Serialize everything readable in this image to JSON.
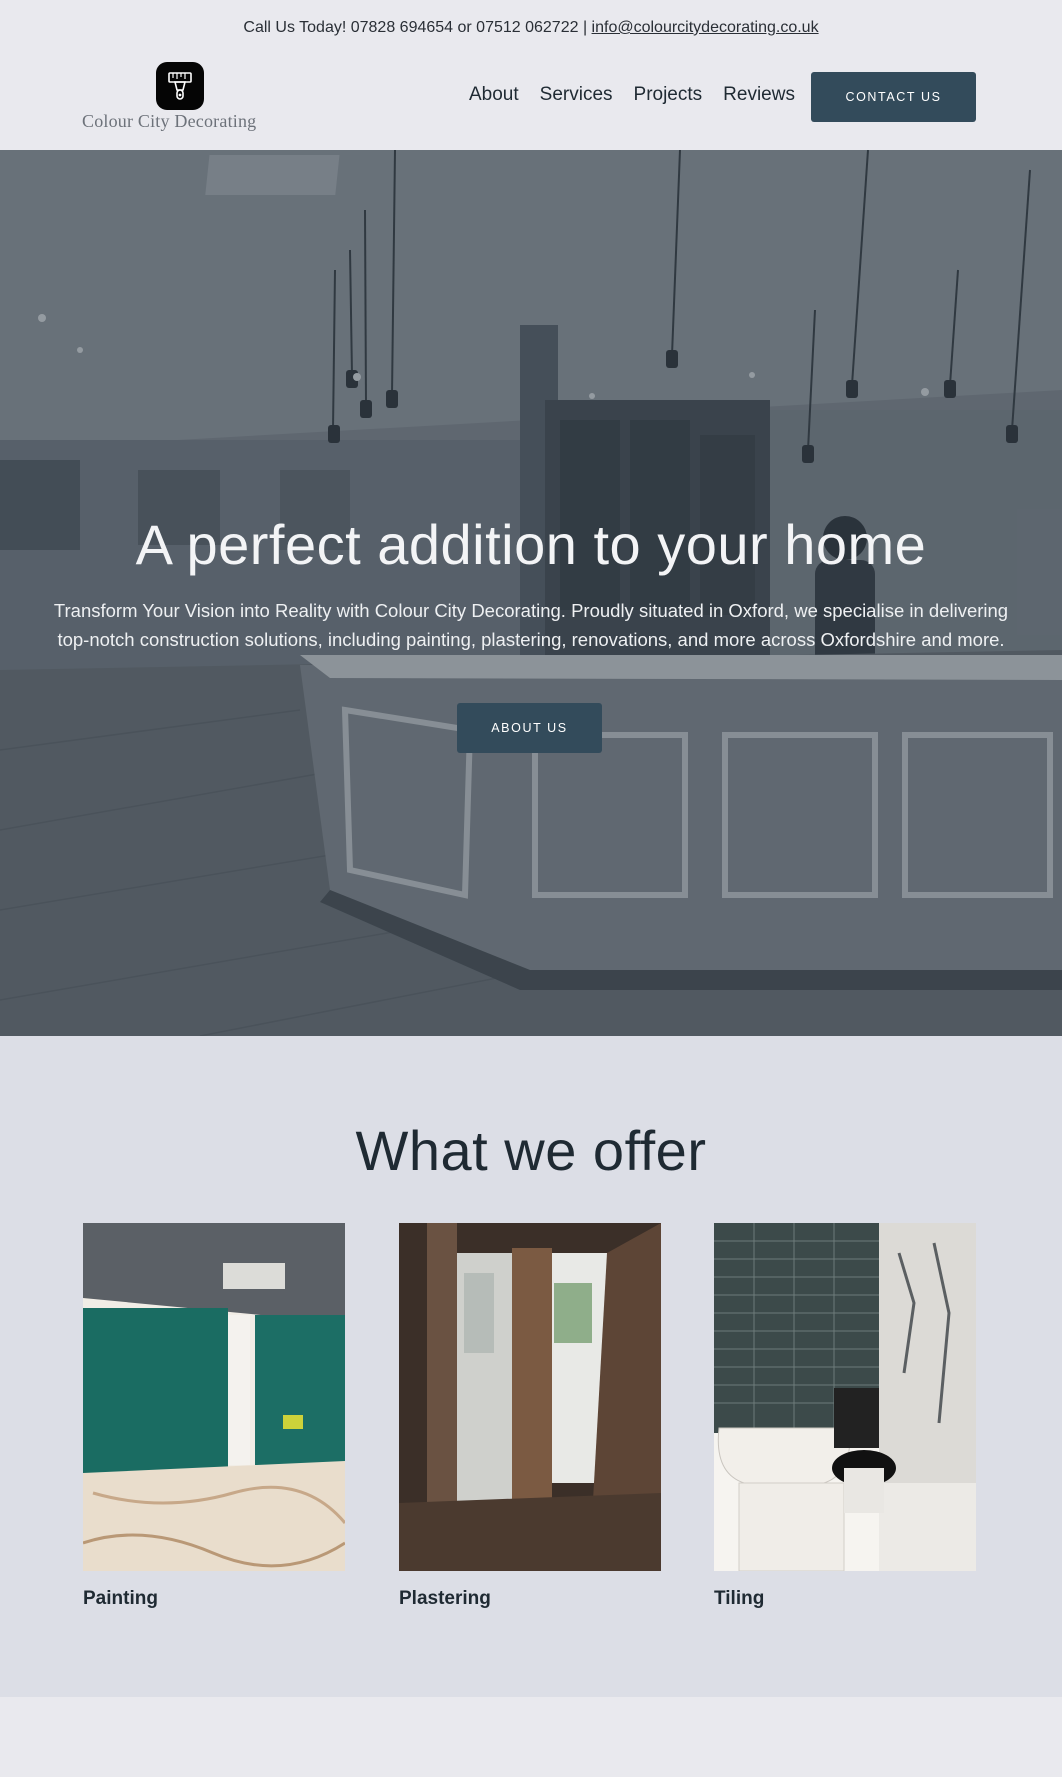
{
  "topbar": {
    "contact_text": "Call Us Today! 07828 694654 or 07512 062722 | ",
    "email": "info@colourcitydecorating.co.uk"
  },
  "logo": {
    "name": "Colour City Decorating",
    "icon": "paint-brush-icon"
  },
  "nav": {
    "items": [
      "About",
      "Services",
      "Projects",
      "Reviews"
    ],
    "cta_label": "CONTACT US"
  },
  "hero": {
    "title": "A perfect addition to your home",
    "subtitle": "Transform Your Vision into Reality with Colour City Decorating. Proudly situated in Oxford, we specialise in delivering top-notch construction solutions, including painting, plastering, renovations, and more across Oxfordshire and more.",
    "button_label": "ABOUT US"
  },
  "offer": {
    "title": "What we offer",
    "cards": [
      {
        "label": "Painting"
      },
      {
        "label": "Plastering"
      },
      {
        "label": "Tiling"
      }
    ]
  },
  "colors": {
    "accent": "#334b5b",
    "page_bg": "#e9e9ee",
    "section_bg": "#dcdee6",
    "text": "#1f2a33"
  }
}
